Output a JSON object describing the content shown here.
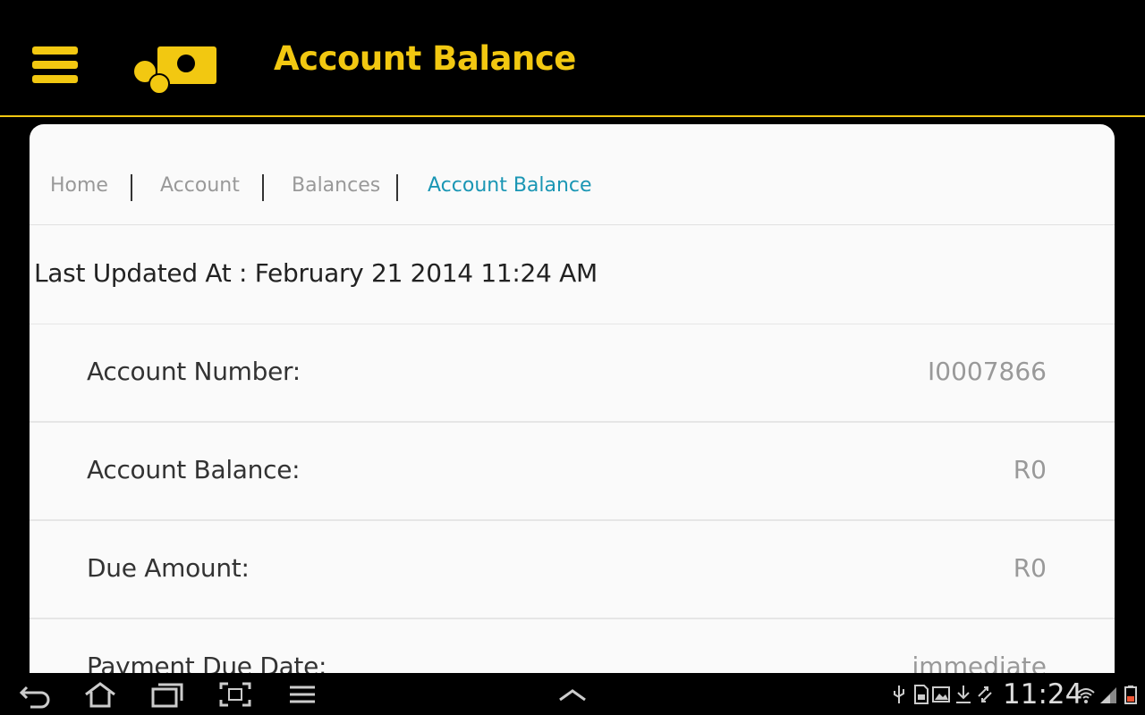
{
  "header": {
    "title": "Account Balance",
    "menu_icon": "hamburger-menu-icon",
    "logo_icon": "coins-banknote-logo",
    "accent_color": "#f2c811"
  },
  "breadcrumb": {
    "items": [
      {
        "label": "Home"
      },
      {
        "label": "Account"
      },
      {
        "label": "Balances"
      },
      {
        "label": "Account Balance",
        "active": true
      }
    ],
    "active_color": "#1a96b4"
  },
  "last_updated": "Last Updated At : February 21 2014 11:24 AM",
  "details": [
    {
      "label": "Account Number:",
      "value": "I0007866"
    },
    {
      "label": "Account Balance:",
      "value": "R0"
    },
    {
      "label": "Due Amount:",
      "value": "R0"
    },
    {
      "label": "Payment Due Date:",
      "value": "immediate"
    }
  ],
  "system_bar": {
    "clock": "11:24",
    "nav_icons": [
      "back-icon",
      "home-icon",
      "recent-apps-icon",
      "screenshot-icon",
      "menu-icon",
      "notifications-up-icon"
    ],
    "status_icons": [
      "usb-icon",
      "sd-card-icon",
      "image-icon",
      "download-icon",
      "sync-icon",
      "wifi-icon",
      "signal-icon",
      "battery-icon"
    ]
  }
}
